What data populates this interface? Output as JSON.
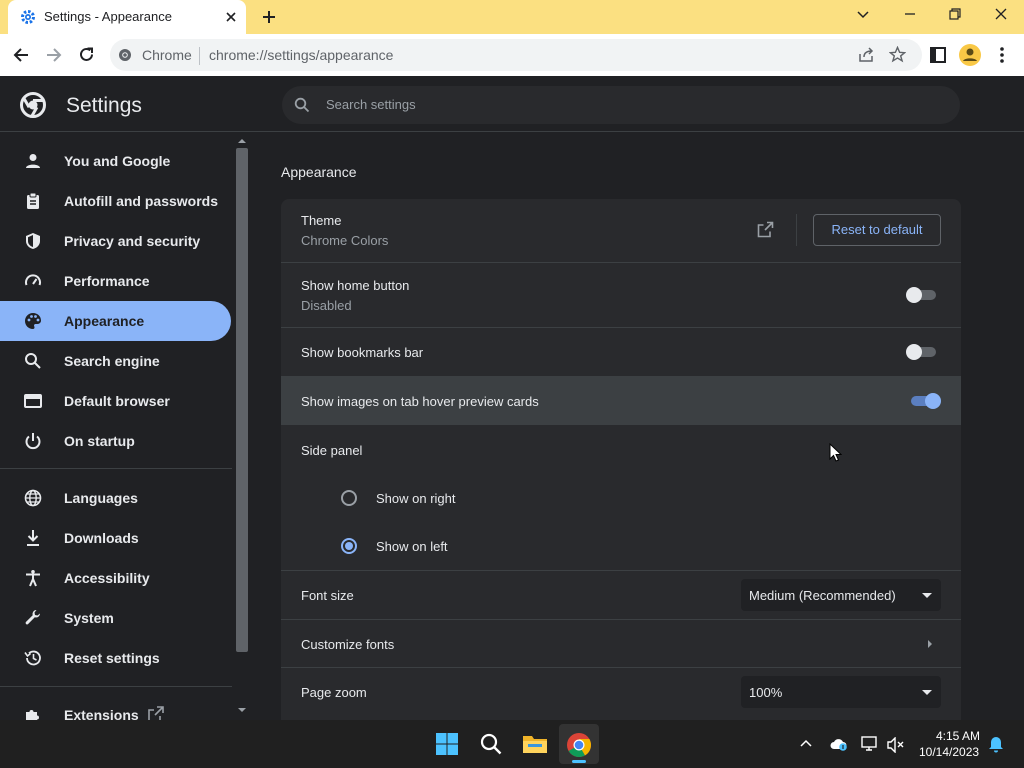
{
  "browser": {
    "tab_title": "Settings - Appearance",
    "omnibox_chip": "Chrome",
    "url": "chrome://settings/appearance"
  },
  "settings": {
    "title": "Settings",
    "search_placeholder": "Search settings"
  },
  "sidebar": {
    "items": [
      {
        "label": "You and Google",
        "icon": "person-icon"
      },
      {
        "label": "Autofill and passwords",
        "icon": "clipboard-icon"
      },
      {
        "label": "Privacy and security",
        "icon": "shield-icon"
      },
      {
        "label": "Performance",
        "icon": "speedometer-icon"
      },
      {
        "label": "Appearance",
        "icon": "palette-icon",
        "active": true
      },
      {
        "label": "Search engine",
        "icon": "search-icon"
      },
      {
        "label": "Default browser",
        "icon": "browser-icon"
      },
      {
        "label": "On startup",
        "icon": "power-icon"
      },
      {
        "label": "Languages",
        "icon": "globe-icon"
      },
      {
        "label": "Downloads",
        "icon": "download-icon"
      },
      {
        "label": "Accessibility",
        "icon": "accessibility-icon"
      },
      {
        "label": "System",
        "icon": "wrench-icon"
      },
      {
        "label": "Reset settings",
        "icon": "history-icon"
      },
      {
        "label": "Extensions",
        "icon": "puzzle-icon"
      }
    ]
  },
  "appearance": {
    "section_title": "Appearance",
    "theme_label": "Theme",
    "theme_value": "Chrome Colors",
    "reset_button": "Reset to default",
    "home_button_label": "Show home button",
    "home_button_value": "Disabled",
    "home_button_on": false,
    "bookmarks_label": "Show bookmarks bar",
    "bookmarks_on": false,
    "hover_label": "Show images on tab hover preview cards",
    "hover_on": true,
    "side_panel_label": "Side panel",
    "side_right_label": "Show on right",
    "side_left_label": "Show on left",
    "side_selected": "left",
    "font_size_label": "Font size",
    "font_size_value": "Medium (Recommended)",
    "customize_fonts_label": "Customize fonts",
    "page_zoom_label": "Page zoom",
    "page_zoom_value": "100%"
  },
  "taskbar": {
    "time": "4:15 AM",
    "date": "10/14/2023"
  },
  "colors": {
    "accent": "#8ab4f8",
    "titlebar": "#fbe081"
  }
}
